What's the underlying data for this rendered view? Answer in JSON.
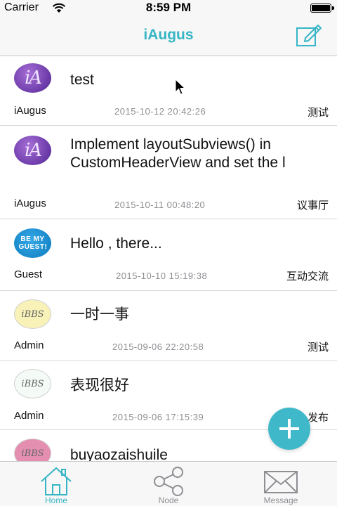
{
  "status_bar": {
    "carrier": "Carrier",
    "time": "8:59 PM"
  },
  "nav": {
    "title": "iAugus",
    "compose_icon": "compose-icon"
  },
  "topics": [
    {
      "title": "test",
      "author": "iAugus",
      "time": "2015-10-12 20:42:26",
      "node": "测试",
      "avatar_text": "iA",
      "avatar_style": "ia"
    },
    {
      "title": "Implement layoutSubviews() in CustomHeaderView and set the l",
      "author": "iAugus",
      "time": "2015-10-11 00:48:20",
      "node": "议事厅",
      "avatar_text": "iA",
      "avatar_style": "ia"
    },
    {
      "title": "Hello , there...",
      "author": "Guest",
      "time": "2015-10-10 15:19:38",
      "node": "互动交流",
      "avatar_text": "BE MY GUEST!",
      "avatar_style": "guest"
    },
    {
      "title": "一时一事",
      "author": "Admin",
      "time": "2015-09-06 22:20:58",
      "node": "测试",
      "avatar_text": "iBBS",
      "avatar_style": "bbs-yellow"
    },
    {
      "title": "表现很好",
      "author": "Admin",
      "time": "2015-09-06 17:15:39",
      "node": "发布",
      "avatar_text": "iBBS",
      "avatar_style": "bbs-mint"
    },
    {
      "title": "buyaozaishuile",
      "avatar_text": "iBBS",
      "avatar_style": "bbs-pink"
    }
  ],
  "fab": {
    "icon": "plus-icon"
  },
  "tabs": [
    {
      "label": "Home",
      "icon": "home-icon",
      "active": true
    },
    {
      "label": "Node",
      "icon": "share-icon",
      "active": false
    },
    {
      "label": "Message",
      "icon": "envelope-icon",
      "active": false
    }
  ],
  "colors": {
    "accent": "#35b5c5",
    "fab": "#3fb8c9",
    "secondary_text": "#8e8e93",
    "bar_background": "#f7f7f7"
  }
}
